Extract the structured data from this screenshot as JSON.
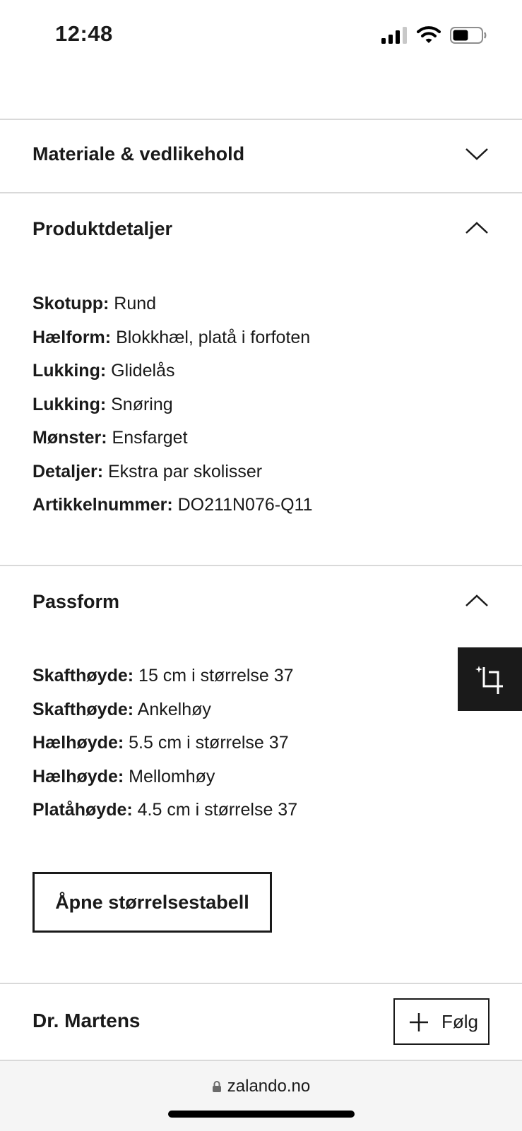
{
  "status_bar": {
    "time": "12:48",
    "battery_level": 0.55
  },
  "sections": {
    "material": {
      "title": "Materiale & vedlikehold",
      "expanded": false
    },
    "product_details": {
      "title": "Produktdetaljer",
      "expanded": true,
      "rows": [
        {
          "key": "Skotupp:",
          "value": "Rund"
        },
        {
          "key": "Hælform:",
          "value": "Blokkhæl, platå i forfoten"
        },
        {
          "key": "Lukking:",
          "value": "Glidelås"
        },
        {
          "key": "Lukking:",
          "value": "Snøring"
        },
        {
          "key": "Mønster:",
          "value": "Ensfarget"
        },
        {
          "key": "Detaljer:",
          "value": "Ekstra par skolisser"
        },
        {
          "key": "Artikkelnummer:",
          "value": "DO211N076-Q11"
        }
      ]
    },
    "fit": {
      "title": "Passform",
      "expanded": true,
      "rows": [
        {
          "key": "Skafthøyde:",
          "value": "15 cm i størrelse 37"
        },
        {
          "key": "Skafthøyde:",
          "value": "Ankelhøy"
        },
        {
          "key": "Hælhøyde:",
          "value": "5.5 cm i størrelse 37"
        },
        {
          "key": "Hælhøyde:",
          "value": "Mellomhøy"
        },
        {
          "key": "Platåhøyde:",
          "value": "4.5 cm i størrelse 37"
        }
      ],
      "size_table_button": "Åpne størrelsestabell"
    }
  },
  "brand": {
    "name": "Dr. Martens",
    "follow_label": "Følg"
  },
  "browser": {
    "url": "zalando.no"
  },
  "icons": {
    "float_button": "crop-sparkle-icon",
    "chevron_collapsed": "chevron-down-icon",
    "chevron_expanded": "chevron-up-icon"
  },
  "colors": {
    "text": "#1a1a1a",
    "divider": "#d9d9d9",
    "float_button": "#1a1a1a"
  }
}
